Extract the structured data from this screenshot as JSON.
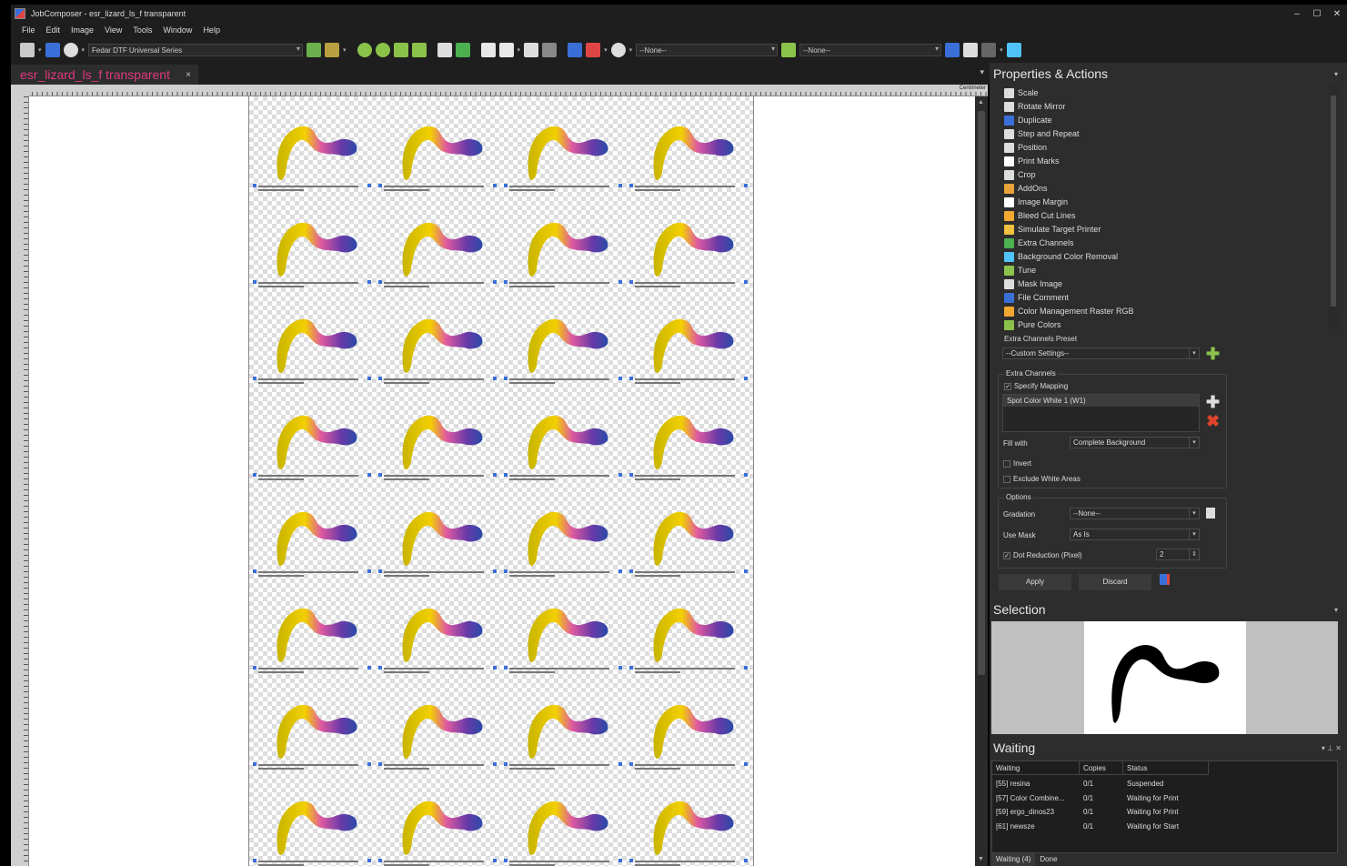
{
  "window": {
    "title": "JobComposer - esr_lizard_ls_f transparent",
    "minimize": "–",
    "maximize": "☐",
    "close": "✕"
  },
  "menu": [
    "File",
    "Edit",
    "Image",
    "View",
    "Tools",
    "Window",
    "Help"
  ],
  "toolbar": {
    "printer": "Fedar DTF Universal Series",
    "combo2": "--None--",
    "combo3": "--None--"
  },
  "document_tab": {
    "name": "esr_lizard_ls_f transparent",
    "close": "×"
  },
  "ruler": {
    "unit": "Centimeter"
  },
  "properties_panel": {
    "title": "Properties & Actions",
    "actions": [
      "Scale",
      "Rotate Mirror",
      "Duplicate",
      "Step and Repeat",
      "Position",
      "Print Marks",
      "Crop",
      "AddOns",
      "Image Margin",
      "Bleed Cut Lines",
      "Simulate Target Printer",
      "Extra Channels",
      "Background Color Removal",
      "Tune",
      "Mask Image",
      "File Comment",
      "Color Management Raster RGB",
      "Pure Colors"
    ],
    "preset_label": "Extra Channels Preset",
    "preset_value": "--Custom Settings--",
    "extra_channels_label": "Extra Channels",
    "specify_mapping": "Specify Mapping",
    "channel_item": "Spot Color White 1 (W1)",
    "fill_with_label": "Fill with",
    "fill_with_value": "Complete Background",
    "invert": "Invert",
    "exclude_white": "Exclude White Areas",
    "options_label": "Options",
    "gradation_label": "Gradation",
    "gradation_value": "--None--",
    "use_mask_label": "Use Mask",
    "use_mask_value": "As Is",
    "dot_reduction_label": "Dot Reduction (Pixel)",
    "dot_reduction_value": "2",
    "apply": "Apply",
    "discard": "Discard"
  },
  "selection_panel": {
    "title": "Selection"
  },
  "waiting_panel": {
    "title": "Waiting",
    "columns": [
      "Waiting",
      "Copies",
      "Status"
    ],
    "rows": [
      [
        "[55]  resina",
        "0/1",
        "Suspended"
      ],
      [
        "[57]  Color Combine...",
        "0/1",
        "Waiting for Print"
      ],
      [
        "[59]  ergo_dinos23",
        "0/1",
        "Waiting for Print"
      ],
      [
        "[61]  newsze",
        "0/1",
        "Waiting for Start"
      ]
    ],
    "tabs": [
      "Waiting (4)",
      "Done"
    ]
  },
  "colors": {
    "accent_tab": "#e0397f",
    "panel_bg": "#2d2d2d",
    "dark_bg": "#1e1e1e",
    "plus_green": "#8bc34a",
    "remove_red": "#e0452b"
  }
}
